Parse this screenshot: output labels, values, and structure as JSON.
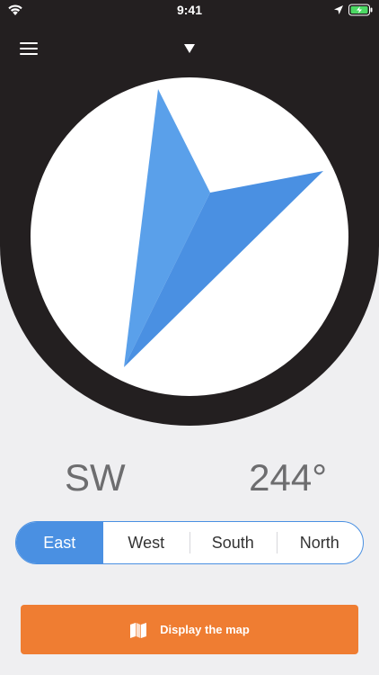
{
  "status_bar": {
    "time": "9:41",
    "icons": [
      "wifi-icon",
      "location-arrow-icon",
      "battery-charging-icon"
    ]
  },
  "header": {
    "menu_icon": "hamburger-menu-icon",
    "marker_icon": "heading-triangle-icon"
  },
  "compass": {
    "direction": "SW",
    "degrees": "244°",
    "arrow_icon": "compass-arrow-icon"
  },
  "segments": {
    "items": [
      {
        "label": "East",
        "active": true
      },
      {
        "label": "West",
        "active": false
      },
      {
        "label": "South",
        "active": false
      },
      {
        "label": "North",
        "active": false
      }
    ]
  },
  "map_button": {
    "label": "Display the map",
    "icon": "map-icon"
  },
  "colors": {
    "header_dark": "#231f20",
    "accent_blue": "#4a90e2",
    "arrow_light": "#5aa0ea",
    "button_orange": "#ef7d32",
    "background": "#efeff1",
    "text_gray": "#6d6d6f"
  }
}
